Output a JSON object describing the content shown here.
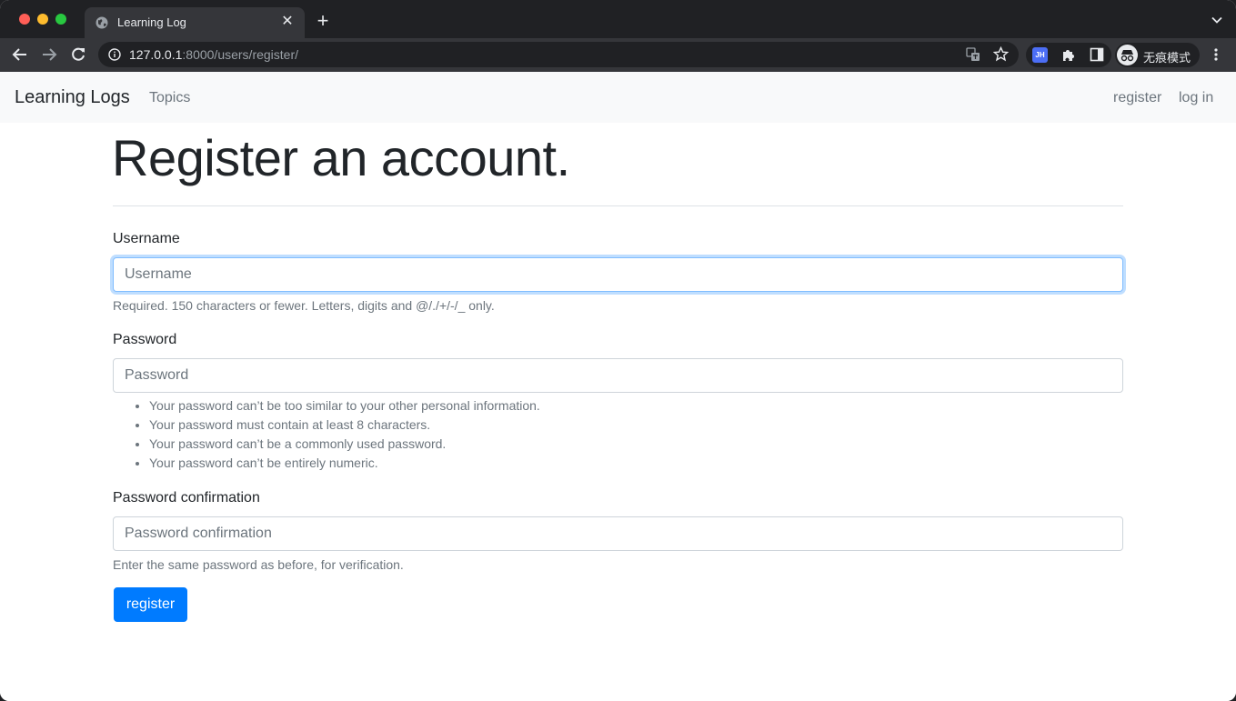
{
  "browser": {
    "tab_title": "Learning Log",
    "tab_close": "✕",
    "new_tab": "+",
    "url_host": "127.0.0.1",
    "url_rest": ":8000/users/register/",
    "extension_badge": "JH",
    "profile_label": "无痕模式"
  },
  "navbar": {
    "brand": "Learning Logs",
    "topics": "Topics",
    "register": "register",
    "login": "log in"
  },
  "main": {
    "title": "Register an account.",
    "username": {
      "label": "Username",
      "placeholder": "Username",
      "help": "Required. 150 characters or fewer. Letters, digits and @/./+/-/_ only."
    },
    "password": {
      "label": "Password",
      "placeholder": "Password",
      "help": [
        "Your password can’t be too similar to your other personal information.",
        "Your password must contain at least 8 characters.",
        "Your password can’t be a commonly used password.",
        "Your password can’t be entirely numeric."
      ]
    },
    "password_confirm": {
      "label": "Password confirmation",
      "placeholder": "Password confirmation",
      "help": "Enter the same password as before, for verification."
    },
    "submit_label": "register"
  },
  "colors": {
    "primary": "#007bff",
    "navbar_bg": "#f8f9fa",
    "muted": "#6c757d",
    "focus_border": "#80bdff"
  }
}
